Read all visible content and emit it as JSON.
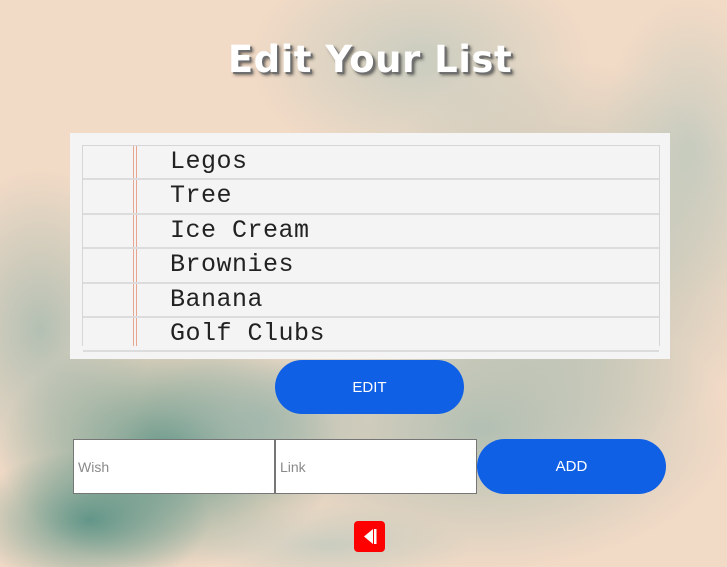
{
  "page": {
    "title": "Edit Your List"
  },
  "wishlist": {
    "items": [
      {
        "label": "Legos"
      },
      {
        "label": "Tree"
      },
      {
        "label": "Ice Cream"
      },
      {
        "label": "Brownies"
      },
      {
        "label": "Banana"
      },
      {
        "label": "Golf Clubs"
      }
    ]
  },
  "actions": {
    "edit_label": "EDIT",
    "add_label": "ADD"
  },
  "form": {
    "wish_placeholder": "Wish",
    "wish_value": "",
    "link_placeholder": "Link",
    "link_value": ""
  },
  "icons": {
    "back": "back-arrow-icon"
  },
  "colors": {
    "button": "#1060e6",
    "back_button": "#ff0000",
    "background": "#f1dac6",
    "paper": "#f4f4f4",
    "margin_line": "#e8a58f"
  }
}
